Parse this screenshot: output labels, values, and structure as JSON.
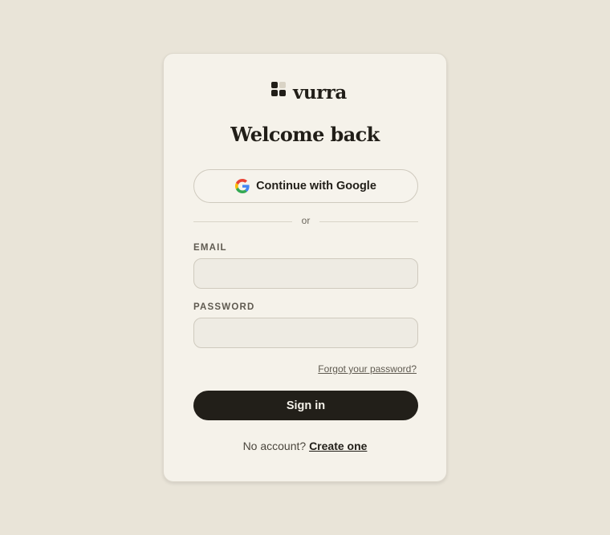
{
  "brand": {
    "name": "vurra",
    "icon": "four-squares-logo-icon"
  },
  "heading": "Welcome back",
  "google_button": {
    "label": "Continue with Google",
    "icon": "google-icon"
  },
  "divider_text": "or",
  "email": {
    "label": "EMAIL",
    "value": "",
    "placeholder": ""
  },
  "password": {
    "label": "PASSWORD",
    "value": "",
    "placeholder": ""
  },
  "forgot_link": "Forgot your password?",
  "signin_button": "Sign in",
  "footer": {
    "prompt": "No account?",
    "link": "Create one"
  },
  "colors": {
    "background": "#e9e4d8",
    "card": "#f5f2ea",
    "primary_button": "#221f19",
    "text": "#211e18"
  }
}
